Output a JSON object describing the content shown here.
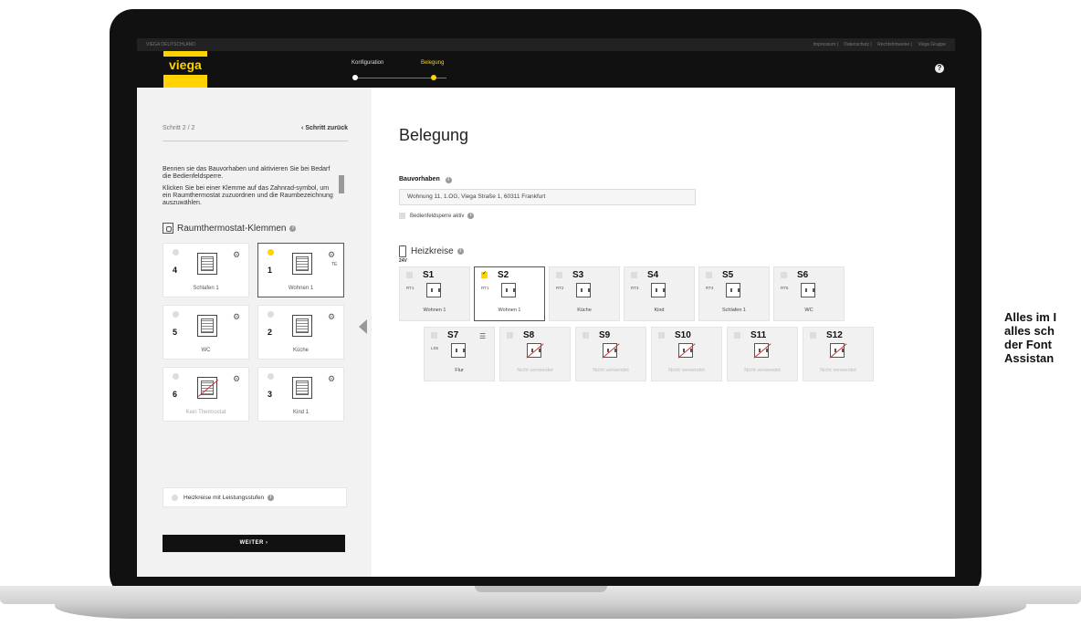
{
  "side_note": [
    "Alles im I",
    "alles sch",
    "der Font",
    "Assistan"
  ],
  "topbar": {
    "brand": "VIEGA DEUTSCHLAND",
    "links": [
      "Impressum",
      "Datenschutz",
      "Rechtshinweise",
      "Viega Gruppe"
    ]
  },
  "nav": {
    "logo": "viega",
    "steps": [
      "Konfiguration",
      "Belegung"
    ],
    "help": "?",
    "colors": {
      "brand": "#ffd200",
      "dark": "#111111"
    }
  },
  "left": {
    "step": "Schritt 2 / 2",
    "back": "‹ Schritt zurück",
    "intro": [
      "Bennen sie das Bauvorhaben und aktivieren Sie bei Bedarf die Bedienfeldsperre.",
      "Klicken Sie bei einer Klemme auf das Zahnrad-symbol, um ein Raumthermostat zuzuordnen und die Raumbezeichnung auszuwählen."
    ],
    "clamps_title": "Raumthermostat-Klemmen",
    "clamps": [
      {
        "num": "4",
        "room": "Schlafen 1",
        "selected": false,
        "extra": ""
      },
      {
        "num": "1",
        "room": "Wohnen 1",
        "selected": true,
        "extra": "TE"
      },
      {
        "num": "5",
        "room": "WC",
        "selected": false,
        "extra": ""
      },
      {
        "num": "2",
        "room": "Küche",
        "selected": false,
        "extra": ""
      },
      {
        "num": "6",
        "room": "Kein Thermostat",
        "selected": false,
        "extra": ""
      },
      {
        "num": "3",
        "room": "Kind 1",
        "selected": false,
        "extra": ""
      }
    ],
    "stages_label": "Heizkreise mit Leistungsstufen",
    "weiter": "WEITER ›"
  },
  "main": {
    "title": "Belegung",
    "bauvorhaben_label": "Bauvorhaben",
    "address": "Wohnung 11, 1.OG, Viega Straße 1, 60311 Frankfurt",
    "lock_label": "Bedienfeldsperre aktiv",
    "heizkreise_label": "Heizkreise",
    "voltage": "24V",
    "tiles": [
      {
        "slot": "S1",
        "rt": "RT1",
        "room": "Wohnen 1",
        "checked": false,
        "selected": false,
        "unused": false
      },
      {
        "slot": "S2",
        "rt": "RT1",
        "room": "Wohnen 1",
        "checked": true,
        "selected": true,
        "unused": false
      },
      {
        "slot": "S3",
        "rt": "RT2",
        "room": "Küche",
        "checked": false,
        "selected": false,
        "unused": false
      },
      {
        "slot": "S4",
        "rt": "RT3",
        "room": "Kind",
        "checked": false,
        "selected": false,
        "unused": false
      },
      {
        "slot": "S5",
        "rt": "RT4",
        "room": "Schlafen 1",
        "checked": false,
        "selected": false,
        "unused": false
      },
      {
        "slot": "S6",
        "rt": "RT5",
        "room": "WC",
        "checked": false,
        "selected": false,
        "unused": false
      },
      {
        "slot": "S7",
        "rt": "LS5",
        "room": "Flur",
        "checked": false,
        "selected": false,
        "unused": false
      },
      {
        "slot": "S8",
        "rt": "",
        "room": "Nicht verwendet",
        "checked": false,
        "selected": false,
        "unused": true
      },
      {
        "slot": "S9",
        "rt": "",
        "room": "Nicht verwendet",
        "checked": false,
        "selected": false,
        "unused": true
      },
      {
        "slot": "S10",
        "rt": "",
        "room": "Nicht verwendet",
        "checked": false,
        "selected": false,
        "unused": true
      },
      {
        "slot": "S11",
        "rt": "",
        "room": "Nicht verwendet",
        "checked": false,
        "selected": false,
        "unused": true
      },
      {
        "slot": "S12",
        "rt": "",
        "room": "Nicht verwendet",
        "checked": false,
        "selected": false,
        "unused": true
      }
    ]
  }
}
